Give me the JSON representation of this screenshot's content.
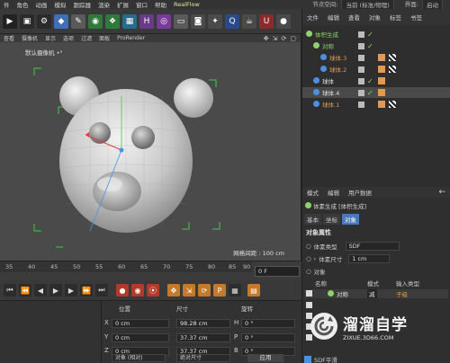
{
  "menubar": {
    "items": [
      "件",
      "角色",
      "动画",
      "模拟",
      "跟踪器",
      "渲染",
      "扩展",
      "窗口",
      "帮助",
      "RealFlow"
    ],
    "node_space_label": "节点空间:",
    "node_space_value": "当前 (标准/物理)",
    "interface_label": "界面:",
    "interface_value": "启动"
  },
  "toolbar": {
    "icons": [
      "clapper-icon",
      "render-region-icon",
      "render-settings-icon",
      "cube-icon",
      "pen-icon",
      "subdivision-icon",
      "generator-icon",
      "volume-icon",
      "deformer-icon",
      "field-icon",
      "floor-icon",
      "camera-icon",
      "light-icon",
      "qr-icon",
      "teapot-icon",
      "magnet-icon",
      "sphere-icon"
    ]
  },
  "object_manager": {
    "tabs": [
      "文件",
      "编辑",
      "查看",
      "对象",
      "标签",
      "书签"
    ],
    "rows": [
      {
        "name": "体积生成",
        "color": "green",
        "indent": 0,
        "selected": false
      },
      {
        "name": "对称",
        "color": "green",
        "indent": 1,
        "selected": false
      },
      {
        "name": "球体.3",
        "color": "orange",
        "indent": 2,
        "selected": false
      },
      {
        "name": "球体.2",
        "color": "orange",
        "indent": 2,
        "selected": false
      },
      {
        "name": "球体",
        "color": "white",
        "indent": 1,
        "selected": false
      },
      {
        "name": "球体.4",
        "color": "white",
        "indent": 1,
        "selected": true
      },
      {
        "name": "球体.1",
        "color": "orange",
        "indent": 1,
        "selected": false
      }
    ]
  },
  "viewport": {
    "menu": [
      "查看",
      "摄像机",
      "显示",
      "选项",
      "过滤",
      "面板",
      "ProRender"
    ],
    "camera_label": "默认摄像机 •°",
    "grid_spacing": "网格间距 : 100 cm"
  },
  "timeline": {
    "ticks": [
      "35",
      "40",
      "45",
      "50",
      "55",
      "60",
      "65",
      "70",
      "75",
      "80",
      "85",
      "90"
    ],
    "current_frame": "0 F"
  },
  "coordinates": {
    "headers": {
      "position": "位置",
      "size": "尺寸",
      "rotation": "旋转"
    },
    "rows": [
      {
        "axis": "X",
        "pos": "0 cm",
        "size": "98.28 cm",
        "rot_label": "H",
        "rot": "0 °"
      },
      {
        "axis": "Y",
        "pos": "0 cm",
        "size": "37.37 cm",
        "rot_label": "P",
        "rot": "0 °"
      },
      {
        "axis": "Z",
        "pos": "0 cm",
        "size": "37.37 cm",
        "rot_label": "B",
        "rot": "0 °"
      }
    ],
    "mode_dropdown": "对象 (相对)",
    "size_dropdown": "绝对尺寸",
    "apply_label": "应用"
  },
  "attributes": {
    "tabs": [
      "模式",
      "编辑",
      "用户数据"
    ],
    "object_title": "体素生成 [体积生成]",
    "subtabs": [
      "基本",
      "坐标",
      "对象"
    ],
    "active_subtab": "对象",
    "section": "对象属性",
    "voxel_type_label": "体素类型",
    "voxel_type_value": "SDF",
    "voxel_size_label": "体素尺寸",
    "voxel_size_value": "1 cm",
    "object_label": "对象",
    "table_headers": [
      "名称",
      "模式",
      "输入类型"
    ],
    "table_rows": [
      {
        "name": "对称",
        "mode": "减",
        "type": "子级"
      }
    ],
    "sdf_smooth_label": "SDF平滑"
  },
  "watermark": {
    "title": "溜溜自学",
    "url": "ZIXUE.3D66.COM"
  },
  "colors": {
    "accent_blue": "#4a78b8",
    "orange": "#e09a55",
    "green": "#8fd16b"
  }
}
